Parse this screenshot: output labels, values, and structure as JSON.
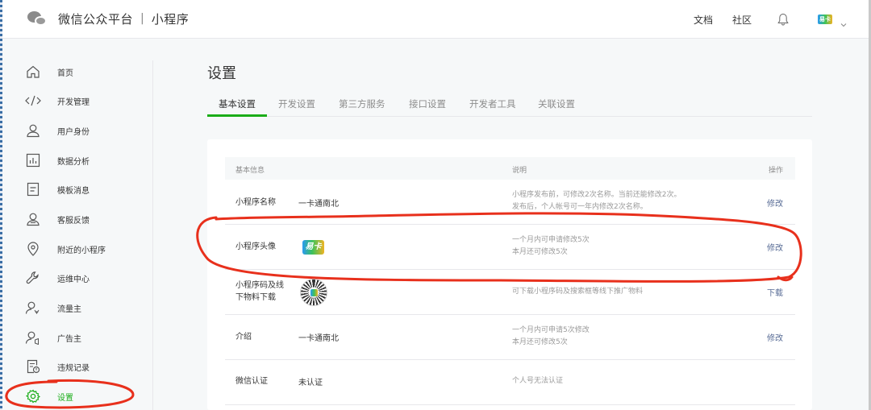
{
  "topbar": {
    "brand_title": "微信公众平台",
    "brand_sep": "|",
    "brand_sub": "小程序",
    "links": [
      "文档",
      "社区"
    ],
    "avatar_text": "易卡"
  },
  "sidebar": {
    "items": [
      {
        "label": "首页",
        "icon": "home-icon"
      },
      {
        "label": "开发管理",
        "icon": "code-icon"
      },
      {
        "label": "用户身份",
        "icon": "user-icon"
      },
      {
        "label": "数据分析",
        "icon": "chart-icon"
      },
      {
        "label": "模板消息",
        "icon": "template-icon"
      },
      {
        "label": "客服反馈",
        "icon": "service-icon"
      },
      {
        "label": "附近的小程序",
        "icon": "location-icon"
      },
      {
        "label": "运维中心",
        "icon": "wrench-icon"
      },
      {
        "label": "流量主",
        "icon": "traffic-user-icon"
      },
      {
        "label": "广告主",
        "icon": "ad-user-icon"
      },
      {
        "label": "违规记录",
        "icon": "violation-icon"
      },
      {
        "label": "设置",
        "icon": "gear-icon"
      }
    ]
  },
  "main": {
    "title": "设置",
    "tabs": [
      "基本设置",
      "开发设置",
      "第三方服务",
      "接口设置",
      "开发者工具",
      "关联设置"
    ],
    "table": {
      "headers": {
        "info": "基本信息",
        "desc": "说明",
        "op": "操作"
      },
      "rows": [
        {
          "label": "小程序名称",
          "value": "一卡通南北",
          "desc": [
            "小程序发布前，可修改2次名称。当前还能修改2次。",
            "发布后，个人帐号可一年内修改2次名称。"
          ],
          "op": "修改"
        },
        {
          "label": "小程序头像",
          "value": "易卡",
          "desc": [
            "一个月内可申请修改5次",
            "本月还可修改5次"
          ],
          "op": "修改"
        },
        {
          "label": "小程序码及线下物料下载",
          "label_lines": [
            "小程序码及线",
            "下物料下载"
          ],
          "desc": [
            "可下载小程序码及搜索框等线下推广物料"
          ],
          "op": "下载"
        },
        {
          "label": "介绍",
          "value": "一卡通南北",
          "desc": [
            "一个月内可申请5次修改",
            "本月还可修改5次"
          ],
          "op": "修改"
        },
        {
          "label": "微信认证",
          "value": "未认证",
          "desc": [
            "个人号无法认证"
          ],
          "op": ""
        }
      ]
    }
  },
  "colors": {
    "accent": "#1aad19",
    "link": "#576b95",
    "annotation": "#e8301c"
  }
}
